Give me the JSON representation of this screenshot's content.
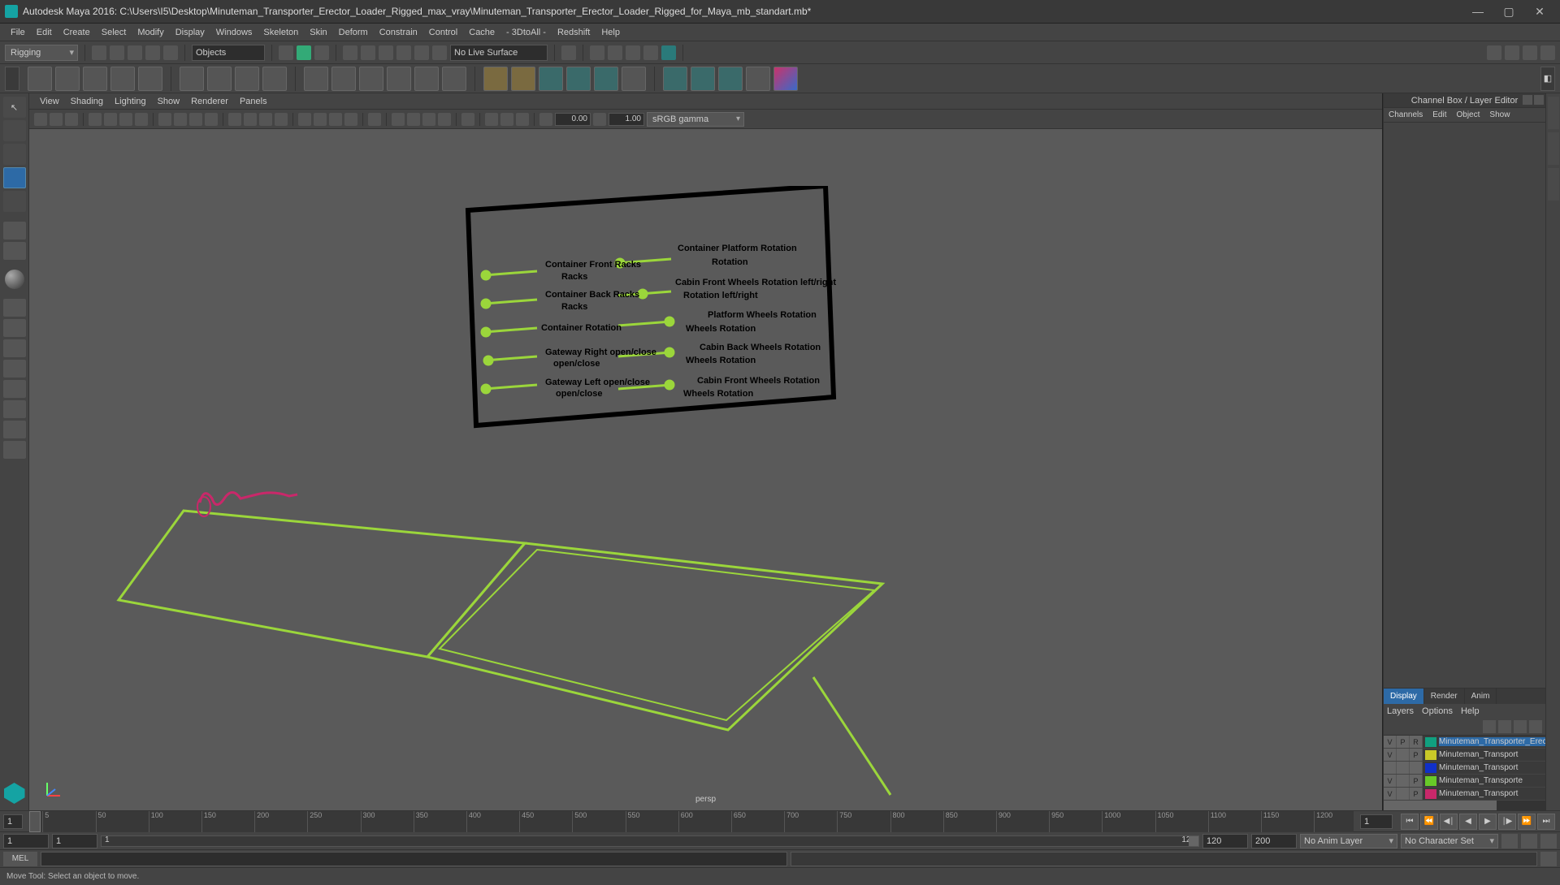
{
  "title": "Autodesk Maya 2016: C:\\Users\\I5\\Desktop\\Minuteman_Transporter_Erector_Loader_Rigged_max_vray\\Minuteman_Transporter_Erector_Loader_Rigged_for_Maya_mb_standart.mb*",
  "menus": [
    "File",
    "Edit",
    "Create",
    "Select",
    "Modify",
    "Display",
    "Windows",
    "Skeleton",
    "Skin",
    "Deform",
    "Constrain",
    "Control",
    "Cache",
    "- 3DtoAll -",
    "Redshift",
    "Help"
  ],
  "workspace": "Rigging",
  "selection_mode": "Objects",
  "live_surface": "No Live Surface",
  "vp_menus": [
    "View",
    "Shading",
    "Lighting",
    "Show",
    "Renderer",
    "Panels"
  ],
  "vp_num1": "0.00",
  "vp_num2": "1.00",
  "colorspace": "sRGB gamma",
  "camera_label": "persp",
  "channel_box_title": "Channel Box / Layer Editor",
  "channel_tabs": [
    "Channels",
    "Edit",
    "Object",
    "Show"
  ],
  "layer_tabs": [
    "Display",
    "Render",
    "Anim"
  ],
  "layer_menus": [
    "Layers",
    "Options",
    "Help"
  ],
  "layers": [
    {
      "v": "V",
      "p": "P",
      "r": "R",
      "color": "#10a080",
      "name": "Minuteman_Transporter_Erec",
      "hl": true
    },
    {
      "v": "V",
      "p": "",
      "r": "P",
      "color": "#c9c928",
      "name": "Minuteman_Transport"
    },
    {
      "v": "",
      "p": "",
      "r": "",
      "color": "#1030c9",
      "name": "Minuteman_Transport"
    },
    {
      "v": "V",
      "p": "",
      "r": "P",
      "color": "#68c928",
      "name": "Minuteman_Transporte"
    },
    {
      "v": "V",
      "p": "",
      "r": "P",
      "color": "#c9286a",
      "name": "Minuteman_Transport"
    }
  ],
  "time_start": "1",
  "time_end": "1",
  "time_ticks": [
    "5",
    "50",
    "100",
    "150",
    "200",
    "250",
    "300",
    "350",
    "400",
    "450",
    "500",
    "550",
    "600",
    "650",
    "700",
    "750",
    "800",
    "850",
    "900",
    "950",
    "1000",
    "1050",
    "1100",
    "1150",
    "1200"
  ],
  "range_start": "1",
  "range_cur": "1",
  "slider_left": "1",
  "slider_right": "120",
  "range_min": "120",
  "range_max": "200",
  "anim_layer": "No Anim Layer",
  "char_set": "No Character Set",
  "cmd_lang": "MEL",
  "help_line": "Move Tool: Select an object to move.",
  "rig_labels": {
    "l1": "Container Front Racks",
    "l2": "Container Back Racks",
    "l3": "Container Rotation",
    "l4": "Gateway Right open/close",
    "l5": "Gateway Left open/close",
    "r1": "Container Platform Rotation",
    "r2": "Cabin Front Wheels Rotation left/right",
    "r3": "Platform Wheels Rotation",
    "r4": "Cabin Back Wheels Rotation",
    "r5": "Cabin Front Wheels Rotation"
  }
}
